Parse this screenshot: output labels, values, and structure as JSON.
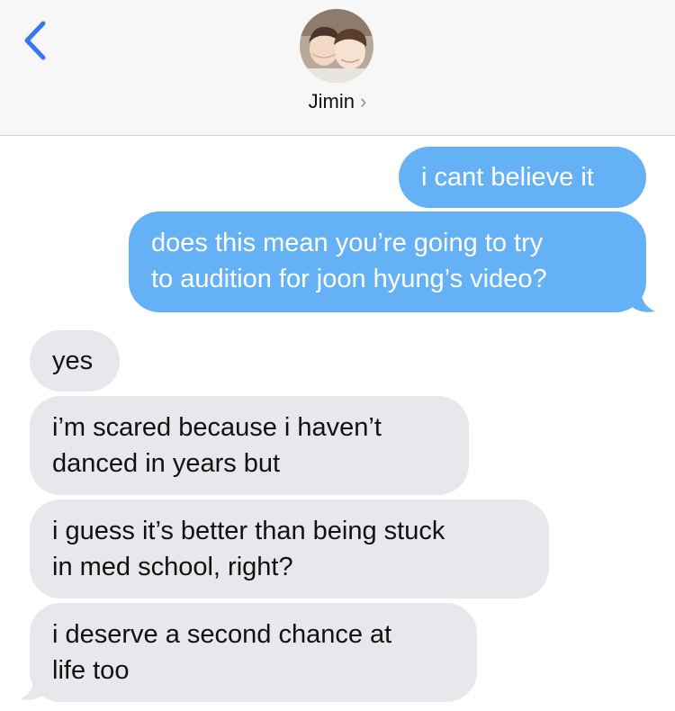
{
  "header": {
    "contact_name": "Jimin",
    "chevron": "›",
    "back_icon": "chevron-left-icon",
    "avatar_icon": "contact-avatar"
  },
  "colors": {
    "outgoing_bubble": "#65b1f6",
    "incoming_bubble": "#e8e8ec",
    "accent": "#3478f6",
    "header_bg": "#f7f7f7"
  },
  "messages": [
    {
      "direction": "outgoing",
      "text": "i cant believe it"
    },
    {
      "direction": "outgoing",
      "text": "does this mean you’re going to try\nto audition for joon hyung’s video?"
    },
    {
      "direction": "incoming",
      "text": "yes"
    },
    {
      "direction": "incoming",
      "text": "i’m scared because i haven’t\ndanced in years but"
    },
    {
      "direction": "incoming",
      "text": "i guess it’s better than being stuck\nin med school, right?"
    },
    {
      "direction": "incoming",
      "text": "i deserve a second chance at\nlife too"
    }
  ]
}
